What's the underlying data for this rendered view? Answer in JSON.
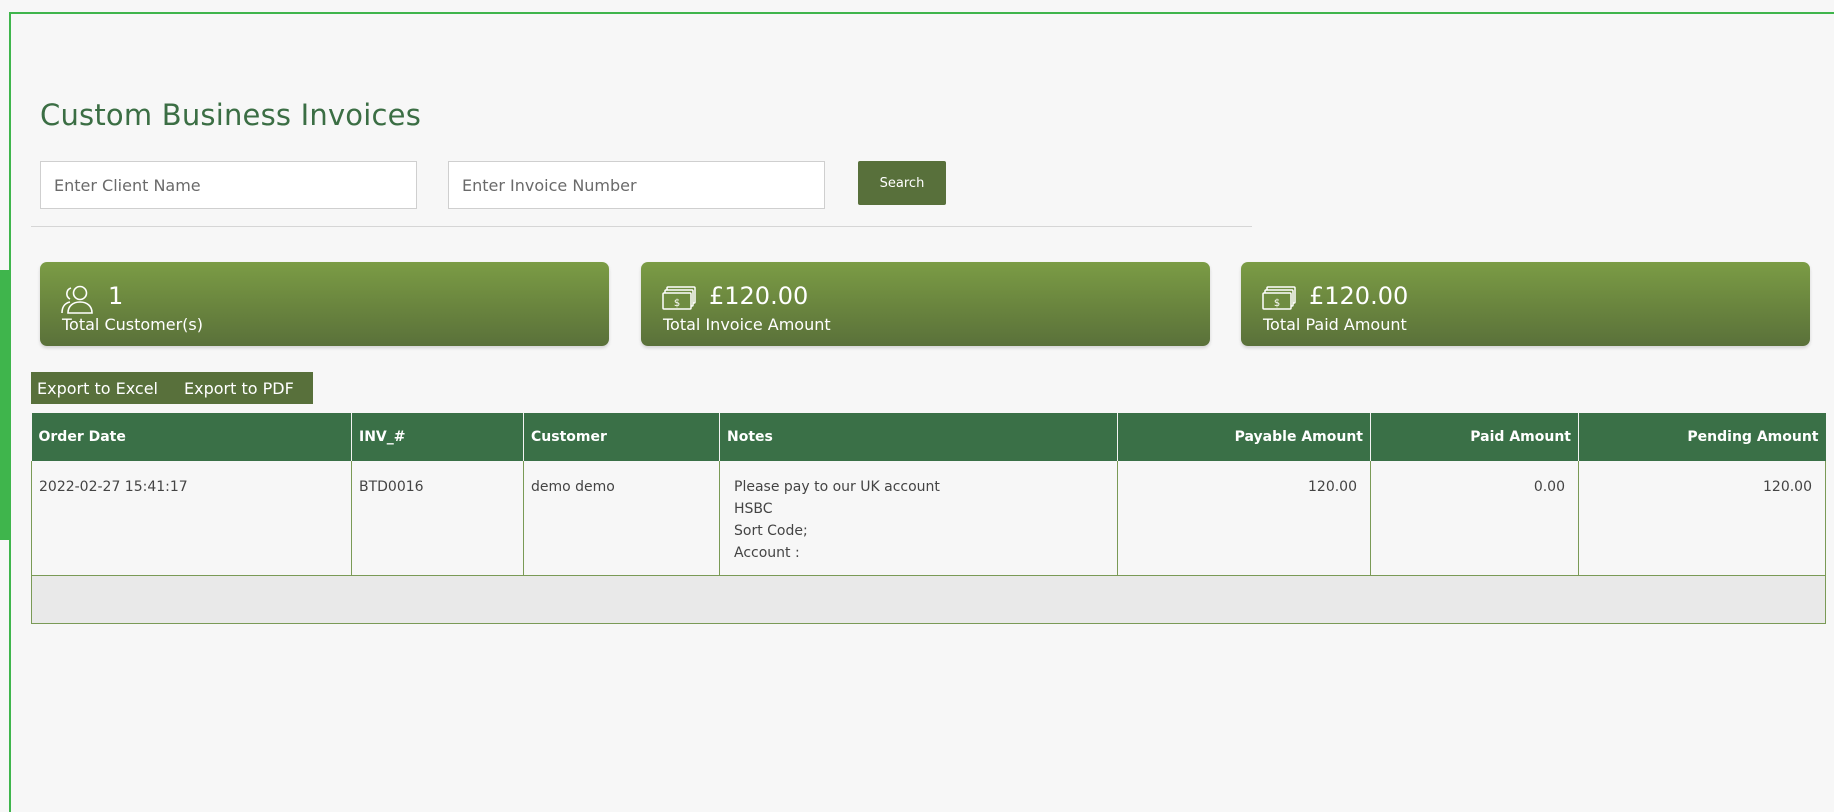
{
  "page": {
    "title": "Custom Business Invoices"
  },
  "search": {
    "client_placeholder": "Enter Client Name",
    "invoice_placeholder": "Enter Invoice Number",
    "button_label": "Search"
  },
  "stats": [
    {
      "value": "1",
      "label": "Total Customer(s)",
      "icon": "users-icon"
    },
    {
      "value": "£120.00",
      "label": "Total Invoice Amount",
      "icon": "money-icon"
    },
    {
      "value": "£120.00",
      "label": "Total Paid Amount",
      "icon": "money-icon"
    }
  ],
  "export": {
    "excel_label": "Export to Excel",
    "pdf_label": "Export to PDF"
  },
  "table": {
    "columns": [
      "Order Date",
      "INV_#",
      "Customer",
      "Notes",
      "Payable Amount",
      "Paid Amount",
      "Pending Amount"
    ],
    "rows": [
      {
        "order_date": "2022-02-27 15:41:17",
        "inv": "BTD0016",
        "customer": "demo demo",
        "notes": [
          "Please pay to our UK account",
          "HSBC",
          "Sort Code;",
          "Account :"
        ],
        "payable": "120.00",
        "paid": "0.00",
        "pending": "120.00"
      }
    ]
  },
  "colors": {
    "accent_green": "#3fb54c",
    "header_green": "#3a7047",
    "button_olive": "#58703b",
    "card_green": "#6b8a3e"
  }
}
